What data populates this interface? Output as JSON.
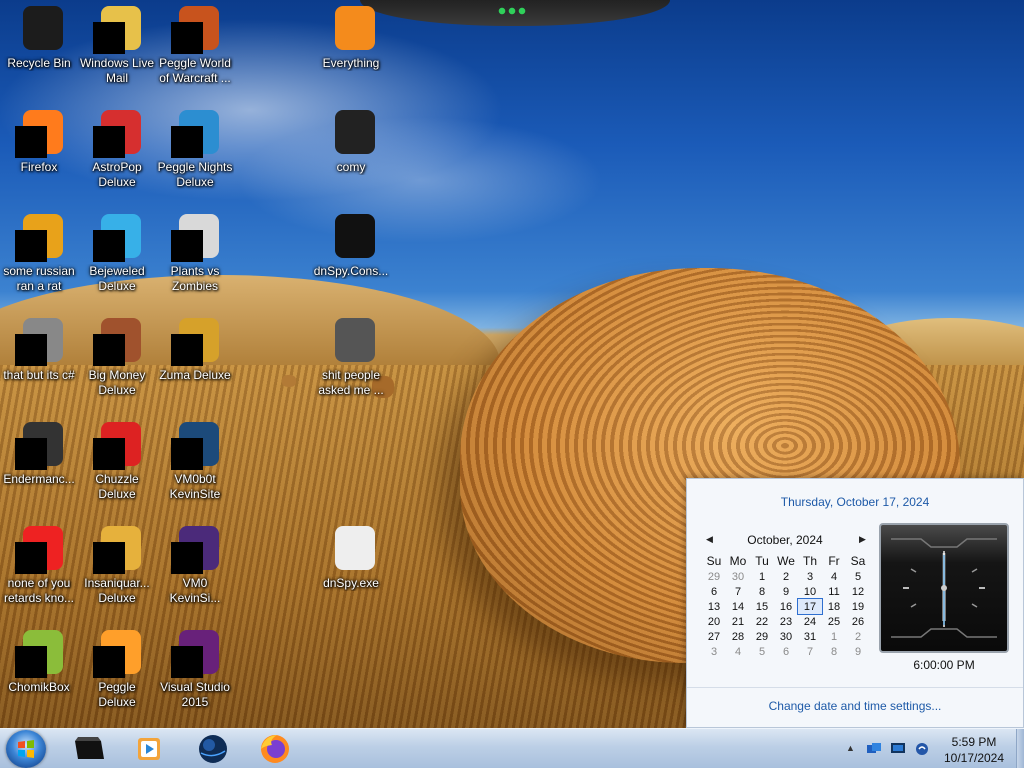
{
  "desktop": {
    "icons": [
      {
        "name": "recycle-bin-icon",
        "label": "Recycle Bin"
      },
      {
        "name": "windows-live-mail-icon",
        "label": "Windows Live\nMail"
      },
      {
        "name": "peggle-world-of-warcraft-icon",
        "label": "Peggle World\nof Warcraft ..."
      },
      {
        "name": "everything-icon",
        "label": "Everything"
      },
      {
        "name": "firefox-icon",
        "label": "Firefox"
      },
      {
        "name": "astropop-deluxe-icon",
        "label": "AstroPop\nDeluxe"
      },
      {
        "name": "peggle-nights-deluxe-icon",
        "label": "Peggle Nights\nDeluxe"
      },
      {
        "name": "comy-icon",
        "label": "comy"
      },
      {
        "name": "some-russian-ran-a-rat-icon",
        "label": "some russian\nran a rat"
      },
      {
        "name": "bejeweled-deluxe-icon",
        "label": "Bejeweled\nDeluxe"
      },
      {
        "name": "plants-vs-zombies-icon",
        "label": "Plants vs\nZombies"
      },
      {
        "name": "dnspy-console-icon",
        "label": "dnSpy.Cons..."
      },
      {
        "name": "that-but-its-csharp-icon",
        "label": "that but its c#"
      },
      {
        "name": "big-money-deluxe-icon",
        "label": "Big Money\nDeluxe"
      },
      {
        "name": "zuma-deluxe-icon",
        "label": "Zuma Deluxe"
      },
      {
        "name": "shit-people-asked-me-icon",
        "label": "shit people\nasked me ..."
      },
      {
        "name": "endermanch-icon",
        "label": "Endermanc..."
      },
      {
        "name": "chuzzle-deluxe-icon",
        "label": "Chuzzle\nDeluxe"
      },
      {
        "name": "vm0b0t-kevinsite-icon",
        "label": "VM0b0t\nKevinSite"
      },
      {
        "name": "none-of-you-retards-icon",
        "label": "none of you\nretards kno..."
      },
      {
        "name": "insaniquarium-deluxe-icon",
        "label": "Insaniquar...\nDeluxe"
      },
      {
        "name": "vm0-kevinsite-icon",
        "label": "VM0\nKevinSi..."
      },
      {
        "name": "dnspy-exe-icon",
        "label": "dnSpy.exe"
      },
      {
        "name": "chomikbox-icon",
        "label": "ChomikBox"
      },
      {
        "name": "peggle-deluxe-icon",
        "label": "Peggle Deluxe"
      },
      {
        "name": "visual-studio-2015-icon",
        "label": "Visual Studio\n2015"
      }
    ]
  },
  "calendar": {
    "header": "Thursday, October 17, 2024",
    "month_title": "October, 2024",
    "prev": "◀",
    "next": "▶",
    "weekdays": [
      "Su",
      "Mo",
      "Tu",
      "We",
      "Th",
      "Fr",
      "Sa"
    ],
    "weeks": [
      [
        "29",
        "30",
        "1",
        "2",
        "3",
        "4",
        "5"
      ],
      [
        "6",
        "7",
        "8",
        "9",
        "10",
        "11",
        "12"
      ],
      [
        "13",
        "14",
        "15",
        "16",
        "17",
        "18",
        "19"
      ],
      [
        "20",
        "21",
        "22",
        "23",
        "24",
        "25",
        "26"
      ],
      [
        "27",
        "28",
        "29",
        "30",
        "31",
        "1",
        "2"
      ],
      [
        "3",
        "4",
        "5",
        "6",
        "7",
        "8",
        "9"
      ]
    ],
    "selected_day": "17",
    "clock_time": "6:00:00 PM",
    "change_link": "Change date and time settings..."
  },
  "taskbar": {
    "pinned": [
      "explorer-icon",
      "media-player-icon",
      "globe-browser-icon",
      "firefox-icon"
    ],
    "tray_icons": [
      "network-icon",
      "display-icon",
      "action-center-icon"
    ],
    "time": "5:59 PM",
    "date": "10/17/2024"
  },
  "colors": {
    "link": "#1e5aa8",
    "taskbar": "#bccfe6"
  }
}
